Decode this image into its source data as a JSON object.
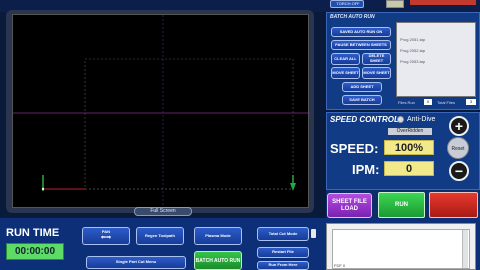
{
  "top": {
    "torch_button_label": "TORCH OFF"
  },
  "canvas": {
    "full_screen_label": "Full Screen"
  },
  "batch_run": {
    "title": "BATCH AUTO RUN",
    "buttons": {
      "save_auto_run": "SAVED AUTO RUN ON",
      "pause_between": "PAUSE BETWEEN SHEETS",
      "clear_all": "CLEAR ALL",
      "delete_sheet": "DELETE SHEET",
      "move_sheet": "MOVE SHEET",
      "move_sheet2": "MOVE SHEET",
      "add_sheet": "ADD SHEET",
      "save_batch": "SAVE BATCH"
    },
    "files": [
      "Prog 2051.tap",
      "Prog 2052.tap",
      "Prog 2053.tap"
    ],
    "files_run_label": "Files Run",
    "files_run_value": "0",
    "total_files_label": "Total Files",
    "total_files_value": "3"
  },
  "speed_control": {
    "title": "SPEED CONTROL",
    "anti_dive_label": "Anti-Dive",
    "overridden_label": "OverRidden",
    "speed_label": "SPEED:",
    "speed_value": "100%",
    "ipm_label": "IPM:",
    "ipm_value": "0",
    "reset_label": "Reset",
    "plus_label": "+",
    "minus_label": "−"
  },
  "actions": {
    "sheet_file_load": "SHEET FILE LOAD",
    "run": "RUN",
    "stop": ""
  },
  "run_time": {
    "label": "RUN TIME",
    "value": "00:00:00"
  },
  "bottom_buttons": {
    "pan": "PAN",
    "regen_toolpath": "Regen Toolpath",
    "plasma_mode": "Plasma Mode",
    "single_part_cut_menu": "Single Part Cut Menu",
    "batch_auto_run": "BATCH AUTO RUN",
    "total_cut_mode": "Total Cut Mode",
    "restart_file": "Restart File",
    "run_from_here": "Run From Here"
  },
  "log": {
    "text": "FDF 0"
  },
  "colors": {
    "accent_blue": "#123b86",
    "run_green": "#1c9a33",
    "stop_red": "#a81a14",
    "value_yellow": "#f2e98a"
  }
}
